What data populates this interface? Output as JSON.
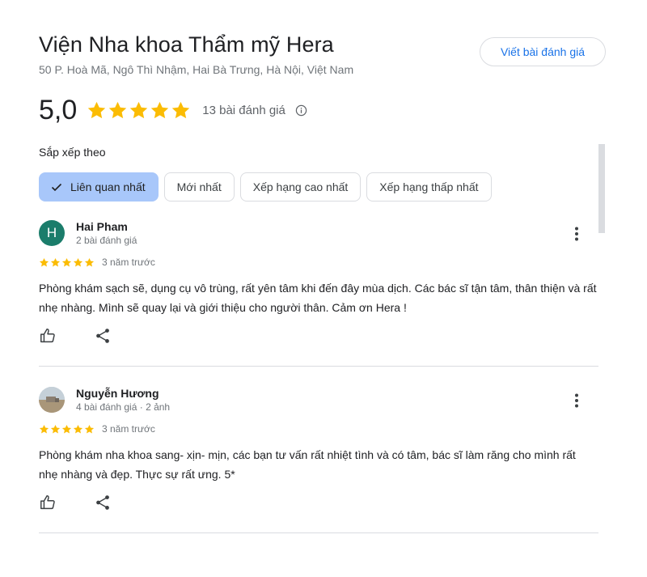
{
  "place": {
    "title": "Viện Nha khoa Thẩm mỹ Hera",
    "address": "50 P. Hoà Mã, Ngô Thì Nhậm, Hai Bà Trưng, Hà Nội, Việt Nam",
    "write_review_label": "Viết bài đánh giá",
    "rating": "5,0",
    "stars": 5,
    "review_count_label": "13 bài đánh giá"
  },
  "sort": {
    "label": "Sắp xếp theo",
    "options": [
      "Liên quan nhất",
      "Mới nhất",
      "Xếp hạng cao nhất",
      "Xếp hạng thấp nhất"
    ],
    "selected": "Liên quan nhất"
  },
  "reviews": [
    {
      "avatar_letter": "H",
      "name": "Hai Pham",
      "meta": "2 bài đánh giá",
      "stars": 5,
      "time": "3 năm trước",
      "text": "Phòng khám sạch sẽ, dụng cụ vô trùng, rất yên tâm khi đến đây mùa dịch. Các bác sĩ tận tâm, thân thiện và rất nhẹ nhàng. Mình sẽ quay lại và giới thiệu cho người thân. Cảm ơn Hera !"
    },
    {
      "avatar_letter": "",
      "name": "Nguyễn Hương",
      "meta": "4 bài đánh giá · 2 ảnh",
      "stars": 5,
      "time": "3 năm trước",
      "text": "Phòng khám nha khoa sang- xịn- mịn, các bạn tư vấn rất nhiệt tình và có tâm, bác sĩ làm răng cho mình rất nhẹ nhàng và đẹp. Thực sự rất ưng. 5*"
    }
  ],
  "colors": {
    "star": "#fbbc04",
    "accent": "#1a73e8",
    "chip_active": "#a8c7fa",
    "avatar_green": "#1b7d6b"
  },
  "icons": {
    "star": "star-icon",
    "info": "info-icon",
    "check": "check-icon",
    "more": "more-vert-icon",
    "like": "thumb-up-icon",
    "share": "share-icon"
  }
}
